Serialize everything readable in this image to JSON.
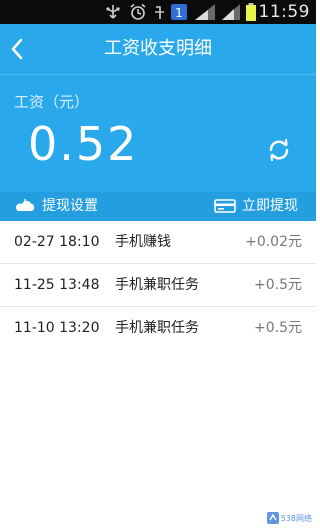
{
  "status_bar": {
    "time": "11:59",
    "icons": [
      "usb-icon",
      "alarm-icon",
      "signal-icon",
      "notification-app-icon",
      "wifi-icon",
      "battery-icon"
    ]
  },
  "header": {
    "title": "工资收支明细",
    "back_icon": "back-arrow-icon"
  },
  "balance": {
    "label": "工资（元）",
    "value": "0.52",
    "refresh_icon": "refresh-icon"
  },
  "actions": {
    "left": {
      "label": "提现设置",
      "icon": "settings-cloud-icon"
    },
    "right": {
      "label": "立即提现",
      "icon": "card-icon"
    }
  },
  "records": [
    {
      "date": "02-27 18:10",
      "desc": "手机赚钱",
      "amount": "+0.02元"
    },
    {
      "date": "11-25 13:48",
      "desc": "手机兼职任务",
      "amount": "+0.5元"
    },
    {
      "date": "11-10 13:20",
      "desc": "手机兼职任务",
      "amount": "+0.5元"
    }
  ],
  "colors": {
    "header_blue": "#2aa8ec",
    "action_bar_blue": "#249edf",
    "status_bar_black": "#0b0b0b",
    "amount_gray": "#777777"
  },
  "watermark": {
    "text": "538网络"
  }
}
